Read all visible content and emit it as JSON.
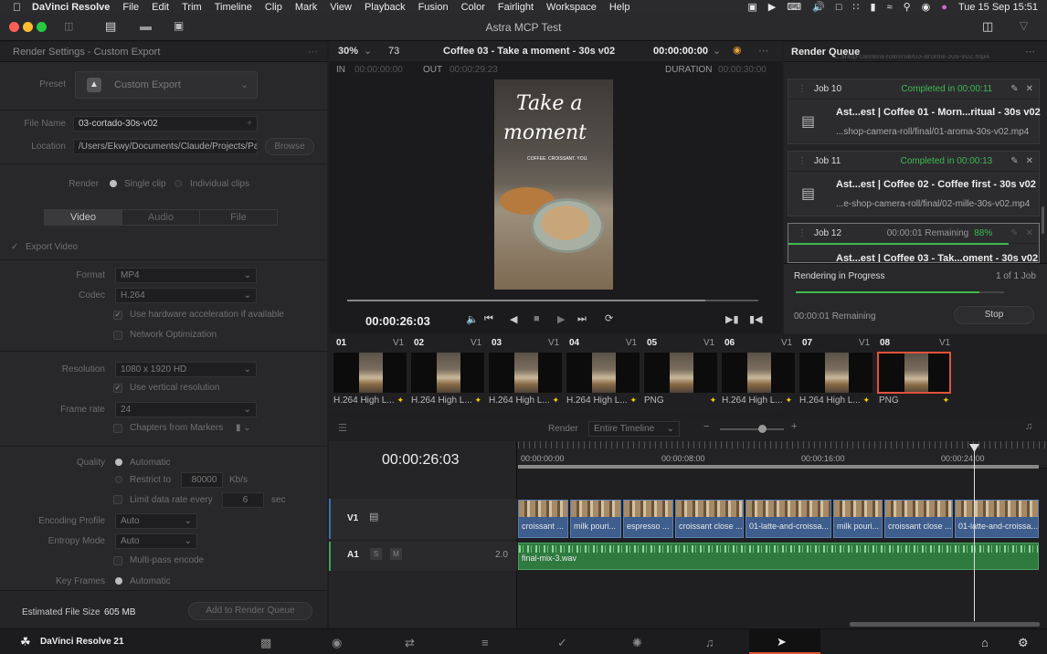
{
  "menubar": {
    "app": "DaVinci Resolve",
    "items": [
      "File",
      "Edit",
      "Trim",
      "Timeline",
      "Clip",
      "Mark",
      "View",
      "Playback",
      "Fusion",
      "Color",
      "Fairlight",
      "Workspace",
      "Help"
    ],
    "clock": "Tue 15 Sep  15:51"
  },
  "window": {
    "title": "Astra MCP Test"
  },
  "render_settings": {
    "header": "Render Settings - Custom Export",
    "preset_label": "Preset",
    "preset_value": "Custom Export",
    "filename_label": "File Name",
    "filename_value": "03-cortado-30s-v02",
    "location_label": "Location",
    "location_value": "/Users/Ekwy/Documents/Claude/Projects/Pa",
    "browse": "Browse",
    "render_label": "Render",
    "single_clip": "Single clip",
    "individual_clips": "Individual clips",
    "tabs": [
      "Video",
      "Audio",
      "File"
    ],
    "export_video": "Export Video",
    "format_label": "Format",
    "format_value": "MP4",
    "codec_label": "Codec",
    "codec_value": "H.264",
    "hw_accel": "Use hardware acceleration if available",
    "network_opt": "Network Optimization",
    "resolution_label": "Resolution",
    "resolution_value": "1080 x 1920 HD",
    "vertical_res": "Use vertical resolution",
    "framerate_label": "Frame rate",
    "framerate_value": "24",
    "chapters": "Chapters from Markers",
    "quality_label": "Quality",
    "automatic": "Automatic",
    "restrict_to": "Restrict to",
    "restrict_value": "80000",
    "kbs": "Kb/s",
    "limit_rate": "Limit data rate every",
    "limit_value": "6",
    "sec": "sec",
    "encoding_profile_label": "Encoding Profile",
    "encoding_profile_value": "Auto",
    "entropy_label": "Entropy Mode",
    "entropy_value": "Auto",
    "multipass": "Multi-pass encode",
    "keyframes_label": "Key Frames",
    "keyframes_value": "Automatic",
    "est_size_label": "Estimated File Size",
    "est_size_value": "605 MB",
    "add_queue": "Add to Render Queue"
  },
  "viewer": {
    "zoom": "30%",
    "frame": "73",
    "clip_name": "Coffee 03 - Take a moment - 30s v02",
    "timecode_top": "00:00:00:00",
    "in_label": "IN",
    "in_value": "00:00:00:00",
    "out_label": "OUT",
    "out_value": "00:00:29:23",
    "duration_label": "DURATION",
    "duration_value": "00:00:30:00",
    "frame_text_1": "Take a",
    "frame_text_2": "moment",
    "frame_text_3": "COFFEE. CROISSANT. YOU.",
    "playhead_tc": "00:00:26:03",
    "scrub_progress": 0.87
  },
  "thumbnails": [
    {
      "num": "01",
      "track": "V1",
      "codec": "H.264 High L..."
    },
    {
      "num": "02",
      "track": "V1",
      "codec": "H.264 High L..."
    },
    {
      "num": "03",
      "track": "V1",
      "codec": "H.264 High L..."
    },
    {
      "num": "04",
      "track": "V1",
      "codec": "H.264 High L..."
    },
    {
      "num": "05",
      "track": "V1",
      "codec": "PNG"
    },
    {
      "num": "06",
      "track": "V1",
      "codec": "H.264 High L..."
    },
    {
      "num": "07",
      "track": "V1",
      "codec": "H.264 High L..."
    },
    {
      "num": "08",
      "track": "V1",
      "codec": "PNG"
    }
  ],
  "timeline": {
    "render_label": "Render",
    "render_value": "Entire Timeline",
    "timecode": "00:00:26:03",
    "ruler": [
      "00:00:00:00",
      "00:00:08:00",
      "00:00:16:00",
      "00:00:24:00"
    ],
    "v1": "V1",
    "a1": "A1",
    "a1_level": "2.0",
    "audio_clip": "final-mix-3.wav",
    "video_clips": [
      "croissant ...",
      "milk pouri...",
      "espresso ...",
      "croissant close ...",
      "01-latte-and-croissa...",
      "milk pouri...",
      "croissant close ...",
      "01-latte-and-croissa..."
    ]
  },
  "render_queue": {
    "header": "Render Queue",
    "top_path": "...shop-camera-roll/final/03-aroma-30s-v02.mp4",
    "jobs": [
      {
        "id": "Job 10",
        "status": "Completed in 00:00:11",
        "title": "Ast...est | Coffee 01 - Morn...ritual - 30s v02",
        "path": "...shop-camera-roll/final/01-aroma-30s-v02.mp4"
      },
      {
        "id": "Job 11",
        "status": "Completed in 00:00:13",
        "title": "Ast...est | Coffee 02 - Coffee first - 30s v02",
        "path": "...e-shop-camera-roll/final/02-mille-30s-v02.mp4"
      },
      {
        "id": "Job 12",
        "status": "00:00:01 Remaining",
        "pct": "88%",
        "title": "Ast...est | Coffee 03 - Tak...oment - 30s v02"
      }
    ],
    "progress_label": "Rendering in Progress",
    "progress_count": "1 of 1 Job",
    "progress": 0.88,
    "remaining": "00:00:01 Remaining",
    "stop": "Stop"
  },
  "bottombar": {
    "app": "DaVinci Resolve 21"
  }
}
